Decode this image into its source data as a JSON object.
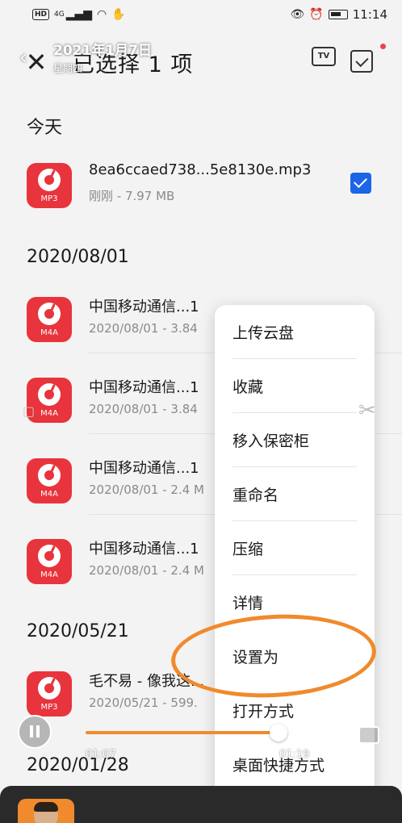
{
  "status_bar": {
    "hd_badge": "HD",
    "network": "4G",
    "time": "11:14"
  },
  "header": {
    "title": "已选择 1 项",
    "tv_label": "TV"
  },
  "overlay": {
    "date": "2021年1月7日",
    "weekday": "星期四"
  },
  "sections": [
    {
      "label": "今天"
    },
    {
      "label": "2020/08/01"
    },
    {
      "label": "2020/05/21"
    },
    {
      "label": "2020/01/28"
    }
  ],
  "files": [
    {
      "name": "8ea6ccaed738...5e8130e.mp3",
      "meta": "刚刚 - 7.97 MB",
      "ext": "MP3",
      "checked": true
    },
    {
      "name": "中国移动通信...1",
      "meta": "2020/08/01 - 3.84",
      "ext": "M4A"
    },
    {
      "name": "中国移动通信...1",
      "meta": "2020/08/01 - 3.84",
      "ext": "M4A"
    },
    {
      "name": "中国移动通信...1",
      "meta": "2020/08/01 - 2.4 M",
      "ext": "M4A"
    },
    {
      "name": "中国移动通信...1",
      "meta": "2020/08/01 - 2.4 M",
      "ext": "M4A"
    },
    {
      "name": "毛不易 - 像我这...",
      "meta": "2020/05/21 - 599.",
      "ext": "MP3"
    }
  ],
  "context_menu": {
    "items": [
      {
        "label": "上传云盘"
      },
      {
        "label": "收藏"
      },
      {
        "label": "移入保密柜"
      },
      {
        "label": "重命名"
      },
      {
        "label": "压缩"
      },
      {
        "label": "详情"
      },
      {
        "label": "设置为"
      },
      {
        "label": "打开方式"
      },
      {
        "label": "桌面快捷方式"
      }
    ]
  },
  "player": {
    "current_time": "01:07",
    "total_time": "01:19",
    "progress": 0.84
  },
  "colors": {
    "accent_orange": "#f08a2c",
    "file_icon_red": "#e8343c",
    "checkbox_blue": "#1e64e6"
  }
}
